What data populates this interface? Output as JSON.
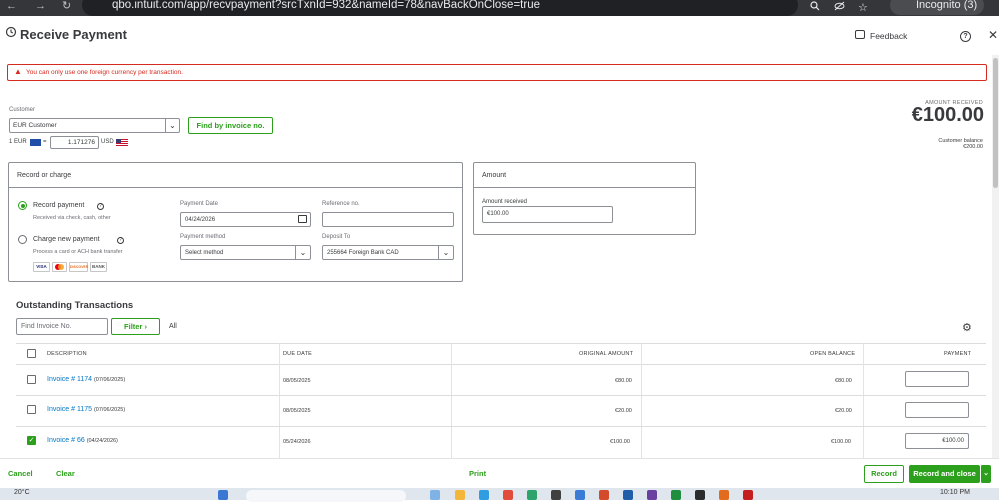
{
  "browser": {
    "back": "←",
    "forward": "→",
    "reload": "↻",
    "url": "qbo.intuit.com/app/recvpayment?srcTxnId=932&nameId=78&navBackOnClose=true",
    "profile_label": "Incognito (3)"
  },
  "header": {
    "title": "Receive Payment",
    "feedback_label": "Feedback",
    "help_glyph": "?",
    "close_glyph": "✕"
  },
  "alert": {
    "message": "You can only use one foreign currency per transaction."
  },
  "customer": {
    "label": "Customer",
    "value": "EUR Customer",
    "find_invoice_label": "Find by invoice no.",
    "rate_prefix": "1 EUR",
    "rate_eq": "=",
    "rate_value": "1.171276",
    "rate_suffix": "USD"
  },
  "summary": {
    "amount_received_label": "AMOUNT RECEIVED",
    "amount_received_value": "€100.00",
    "balance_label": "Customer balance",
    "balance_value": "€200.00"
  },
  "record_panel": {
    "title": "Record or charge",
    "record_payment_label": "Record payment",
    "record_payment_sub": "Received via check, cash, other",
    "charge_payment_label": "Charge new payment",
    "charge_payment_sub": "Process a card or ACH bank transfer",
    "record_payment_selected": true,
    "payment_date_label": "Payment Date",
    "payment_date_value": "04/24/2026",
    "reference_label": "Reference no.",
    "reference_value": "",
    "payment_method_label": "Payment method",
    "payment_method_value": "Select method",
    "deposit_to_label": "Deposit To",
    "deposit_to_value": "255664 Foreign Bank CAD",
    "cards": [
      "VISA",
      "",
      "DISCOVER",
      "BANK"
    ]
  },
  "amount_panel": {
    "title": "Amount",
    "amount_label": "Amount received",
    "amount_value": "€100.00"
  },
  "outstanding": {
    "title": "Outstanding Transactions",
    "find_placeholder": "Find Invoice No.",
    "filter_label": "Filter",
    "all_label": "All",
    "columns": [
      "DESCRIPTION",
      "DUE DATE",
      "ORIGINAL AMOUNT",
      "OPEN BALANCE",
      "PAYMENT"
    ],
    "rows": [
      {
        "invoice": "Invoice # 1174",
        "inv_date": "(07/06/2025)",
        "due_date": "08/05/2025",
        "original": "€80.00",
        "open": "€80.00",
        "payment": "",
        "checked": false
      },
      {
        "invoice": "Invoice # 1175",
        "inv_date": "(07/06/2025)",
        "due_date": "08/05/2025",
        "original": "€20.00",
        "open": "€20.00",
        "payment": "",
        "checked": false
      },
      {
        "invoice": "Invoice # 66",
        "inv_date": "(04/24/2026)",
        "due_date": "05/24/2026",
        "original": "€100.00",
        "open": "€100.00",
        "payment": "€100.00",
        "checked": true
      }
    ]
  },
  "footer": {
    "cancel_label": "Cancel",
    "clear_label": "Clear",
    "print_label": "Print",
    "record_label": "Record",
    "record_close_label": "Record and close"
  },
  "taskbar": {
    "weather": "20°C",
    "time": "10:10 PM"
  },
  "colors": {
    "accent": "#2ca01c",
    "link": "#0077c5",
    "error": "#d52b1e",
    "text": "#393a3d"
  }
}
